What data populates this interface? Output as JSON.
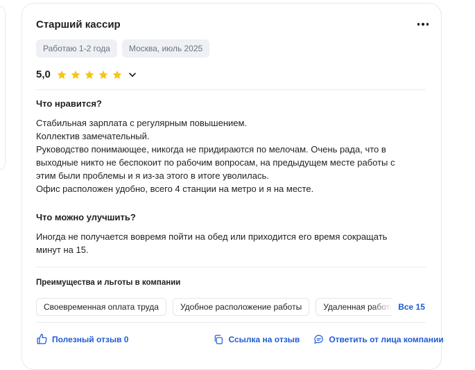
{
  "review": {
    "title": "Старший кассир",
    "tags": [
      "Работаю 1-2 года",
      "Москва, июль 2025"
    ],
    "rating": "5,0",
    "stars": 5,
    "pros_title": "Что нравится?",
    "pros_lines": [
      "Стабильная зарплата с регулярным повышением.",
      "Коллектив замечательный.",
      "Руководство понимающее, никогда не придираются по мелочам. Очень рада, что в",
      "выходные никто не беспокоит по рабочим вопросам, на предыдущем месте работы с",
      "этим были проблемы и я из-за этого в итоге уволилась.",
      "Офис расположен удобно, всего 4 станции на метро и я на месте."
    ],
    "cons_title": "Что можно улучшить?",
    "cons_lines": [
      "Иногда не получается вовремя пойти на обед или приходится его время сокращать",
      "минут на 15."
    ]
  },
  "benefits": {
    "title": "Преимущества и льготы в компании",
    "items": [
      "Своевременная оплата труда",
      "Удобное расположение работы",
      "Удаленная работа"
    ],
    "all_label": "Все 15"
  },
  "footer": {
    "helpful_label": "Полезный отзыв 0",
    "link_label": "Ссылка на отзыв",
    "reply_label": "Ответить от лица компании"
  },
  "colors": {
    "accent": "#1f5bd6",
    "star": "#f5c518",
    "chip_bg": "#eef0f4"
  },
  "icons": [
    "more-icon",
    "star-icon",
    "chevron-down-icon",
    "thumbs-up-icon",
    "copy-link-icon",
    "comment-icon"
  ]
}
